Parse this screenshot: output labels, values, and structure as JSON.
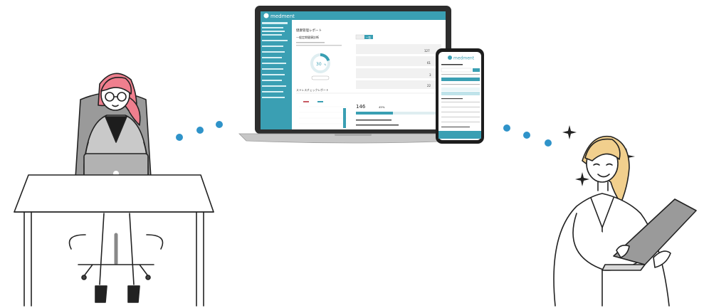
{
  "colors": {
    "teal": "#3a9fb3",
    "teal_light": "#bfe3ea",
    "pink_hair": "#ef7f8e",
    "blonde_hair": "#f1cf8d",
    "dot_blue": "#2f93c9",
    "laptop_body": "#7b7b7b",
    "sparkle": "#222222"
  },
  "laptop_ui": {
    "logo": "medment",
    "sidebar_items": [
      "ホーム",
      "",
      "",
      "",
      "",
      "",
      "",
      "",
      "",
      "",
      "",
      "",
      "",
      "",
      ""
    ],
    "page_title": "健康管理レポート",
    "section_left_title": "一般定期健康診断",
    "donut_value": "30",
    "donut_unit": "%",
    "button_label": "",
    "toggle": [
      "",
      "一覧"
    ],
    "stress_section": "ストレスチェックレポート",
    "stress_left": "",
    "stress_right": "",
    "stress_value": "146",
    "stress_pct": "45%",
    "kpi_values": [
      "127",
      "61",
      "3",
      "22"
    ]
  },
  "phone_ui": {
    "logo": "medment"
  }
}
